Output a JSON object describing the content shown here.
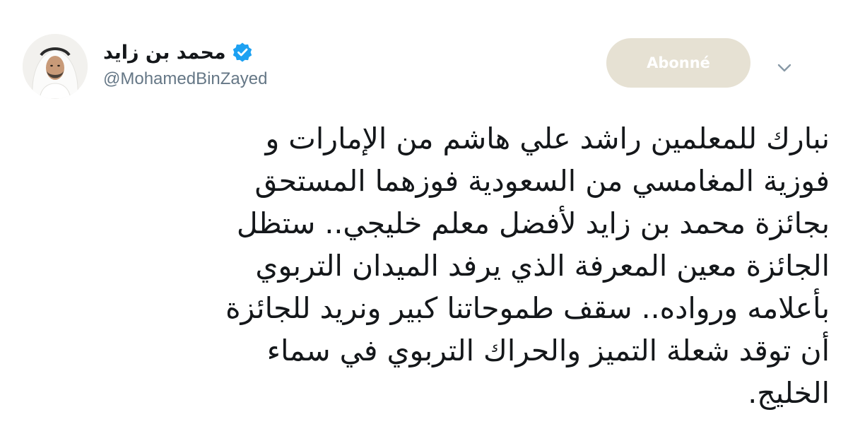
{
  "author": {
    "display_name": "محمد بن زايد",
    "handle": "@MohamedBinZayed",
    "verified": true,
    "avatar": "profile-photo"
  },
  "actions": {
    "follow_label": "Abonné",
    "menu_icon": "chevron-down-icon"
  },
  "tweet": {
    "lines": [
      "نبارك للمعلمين راشد علي هاشم من الإمارات و",
      "فوزية المغامسي من السعودية فوزهما المستحق",
      "بجائزة محمد بن زايد لأفضل معلم خليجي.. ستظل",
      "الجائزة معين المعرفة الذي يرفد الميدان التربوي",
      "بأعلامه ورواده.. سقف طموحاتنا كبير ونريد للجائزة",
      "أن توقد شعلة التميز والحراك التربوي في سماء",
      "الخليج."
    ]
  },
  "colors": {
    "follow_button_bg": "#e6e1d3",
    "verified_badge": "#1da1f2",
    "handle_text": "#657786",
    "text": "#14171a"
  }
}
